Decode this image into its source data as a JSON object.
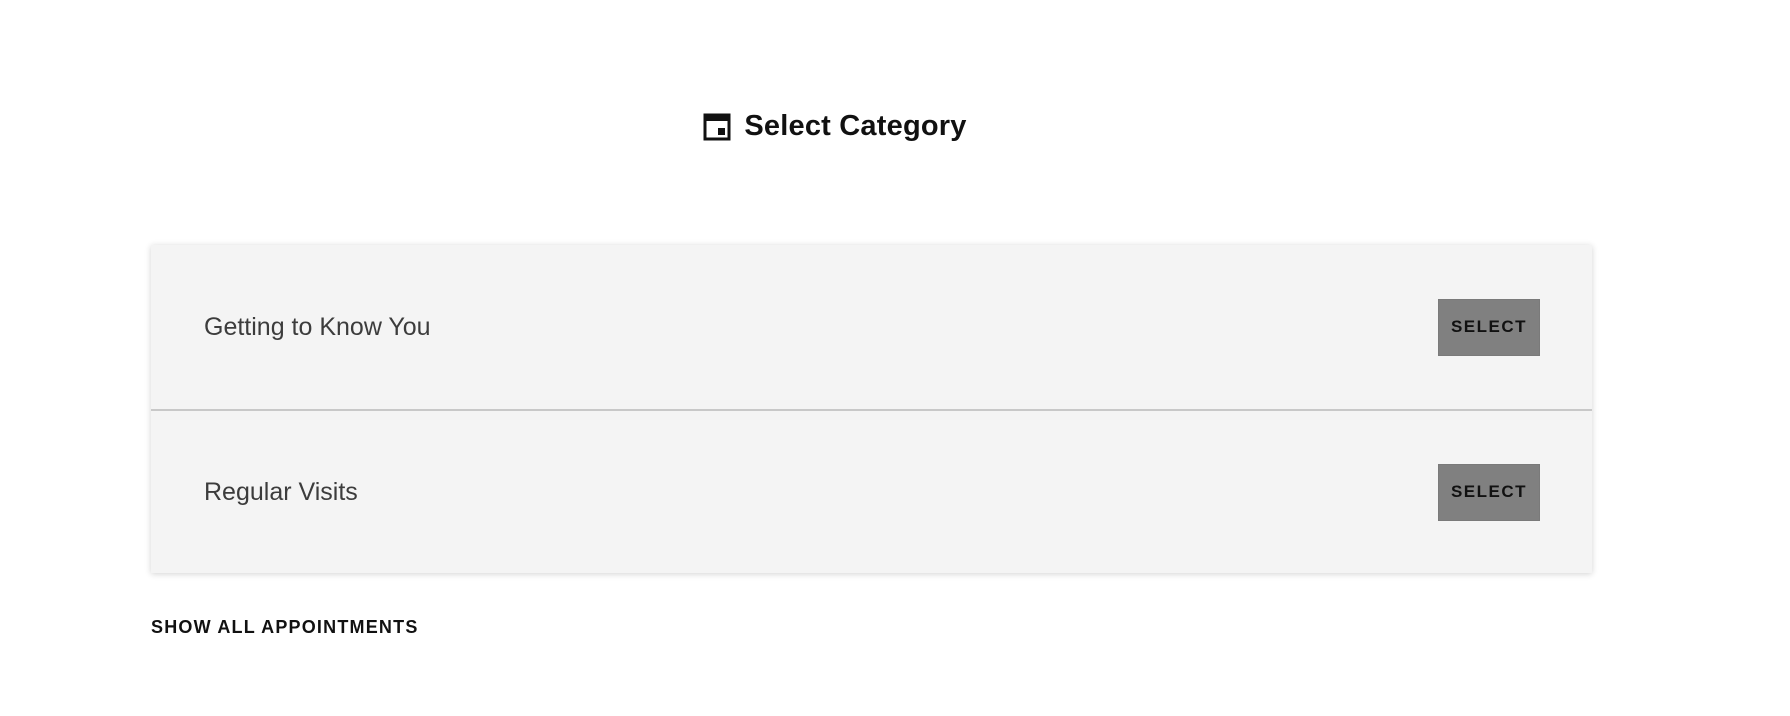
{
  "header": {
    "icon": "calendar-icon",
    "title": "Select Category"
  },
  "categories": [
    {
      "label": "Getting to Know You",
      "button_label": "SELECT"
    },
    {
      "label": "Regular Visits",
      "button_label": "SELECT"
    }
  ],
  "footer": {
    "show_all_label": "SHOW ALL APPOINTMENTS"
  },
  "colors": {
    "card_background": "#f4f4f4",
    "button_background": "#808080",
    "divider": "#c8c8c8"
  }
}
